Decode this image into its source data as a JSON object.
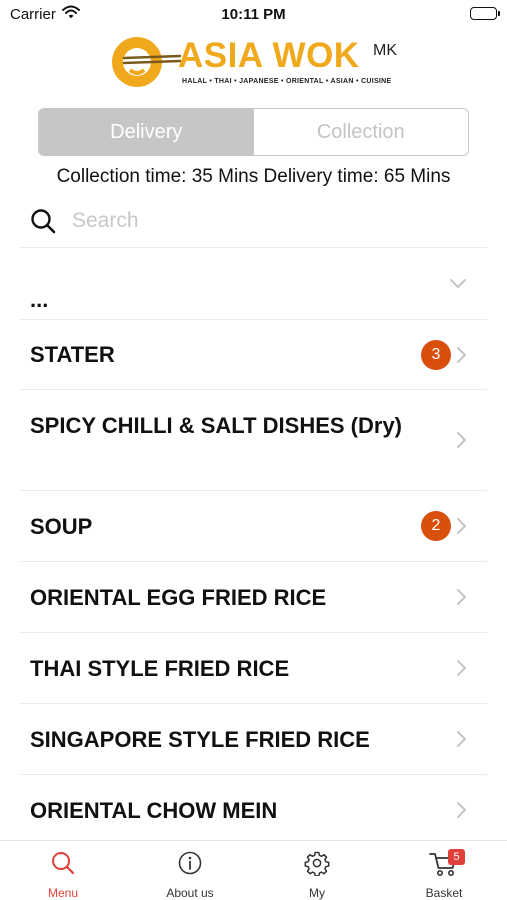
{
  "status_bar": {
    "carrier": "Carrier",
    "time": "10:11 PM"
  },
  "brand": {
    "title": "ASIA WOK",
    "superscript": "MK",
    "tagline": "HALAL • THAI • JAPANESE • ORIENTAL • ASIAN • CUISINE",
    "color": "#f0a81c"
  },
  "order_type": {
    "options": [
      "Delivery",
      "Collection"
    ],
    "selected": "Delivery"
  },
  "times_text": "Collection time: 35 Mins  Delivery time: 65 Mins",
  "search": {
    "placeholder": "Search",
    "value": ""
  },
  "menu_categories": [
    {
      "label": "...",
      "badge": "",
      "chevron": "chevron-down-icon"
    },
    {
      "label": "STATER",
      "badge": "3",
      "chevron": "chevron-right-icon"
    },
    {
      "label": "SPICY CHILLI & SALT DISHES (Dry)",
      "badge": "",
      "chevron": "chevron-right-icon"
    },
    {
      "label": "SOUP",
      "badge": "2",
      "chevron": "chevron-right-icon"
    },
    {
      "label": "ORIENTAL EGG FRIED RICE",
      "badge": "",
      "chevron": "chevron-right-icon"
    },
    {
      "label": "THAI STYLE FRIED RICE",
      "badge": "",
      "chevron": "chevron-right-icon"
    },
    {
      "label": "SINGAPORE STYLE FRIED RICE",
      "badge": "",
      "chevron": "chevron-right-icon"
    },
    {
      "label": "ORIENTAL CHOW MEIN",
      "badge": "",
      "chevron": "chevron-right-icon"
    }
  ],
  "tabs": [
    {
      "label": "Menu",
      "icon": "search-icon",
      "active": true
    },
    {
      "label": "About us",
      "icon": "info-icon",
      "active": false
    },
    {
      "label": "My",
      "icon": "gear-icon",
      "active": false
    },
    {
      "label": "Basket",
      "icon": "cart-icon",
      "active": false,
      "badge": "5"
    }
  ],
  "colors": {
    "accent": "#e0403a",
    "badge": "#d94f0c",
    "segment_active": "#c6c6c6"
  }
}
